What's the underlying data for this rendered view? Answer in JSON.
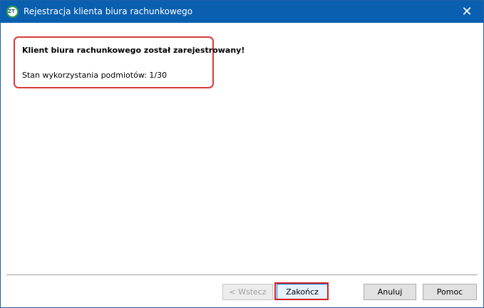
{
  "window": {
    "title": "Rejestracja klienta biura rachunkowego",
    "close_glyph": "✕",
    "app_icon": "app-logo-icon"
  },
  "message": {
    "main": "Klient biura rachunkowego został zarejestrowany!",
    "usage": "Stan wykorzystania podmiotów: 1/30"
  },
  "buttons": {
    "back": "< Wstecz",
    "finish": "Zakończ",
    "cancel": "Anuluj",
    "help": "Pomoc"
  },
  "colors": {
    "titlebar": "#0a5fb0",
    "highlight": "#d83a3a"
  }
}
